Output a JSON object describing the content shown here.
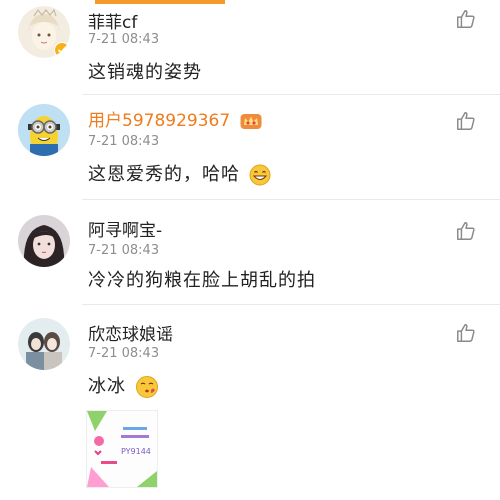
{
  "comments": [
    {
      "username": "菲菲cf",
      "time": "7-21 08:43",
      "text": "这销魂的姿势"
    },
    {
      "username": "用户5978929367",
      "time": "7-21 08:43",
      "text": "这恩爱秀的，哈哈"
    },
    {
      "username": "阿寻啊宝-",
      "time": "7-21 08:43",
      "text": "冷冷的狗粮在脸上胡乱的拍"
    },
    {
      "username": "欣恋球娘谣",
      "time": "7-21 08:43",
      "text": "冰冰"
    }
  ],
  "attachment": {
    "code": "PY9144"
  },
  "colors": {
    "accent": "#f39a2b",
    "vip_name": "#ef7c1a",
    "time": "#8e8e8e",
    "text": "#222222"
  },
  "icons": {
    "like": "thumbs-up-icon",
    "verified": "verified-badge-icon",
    "vip": "crown-badge-icon"
  }
}
